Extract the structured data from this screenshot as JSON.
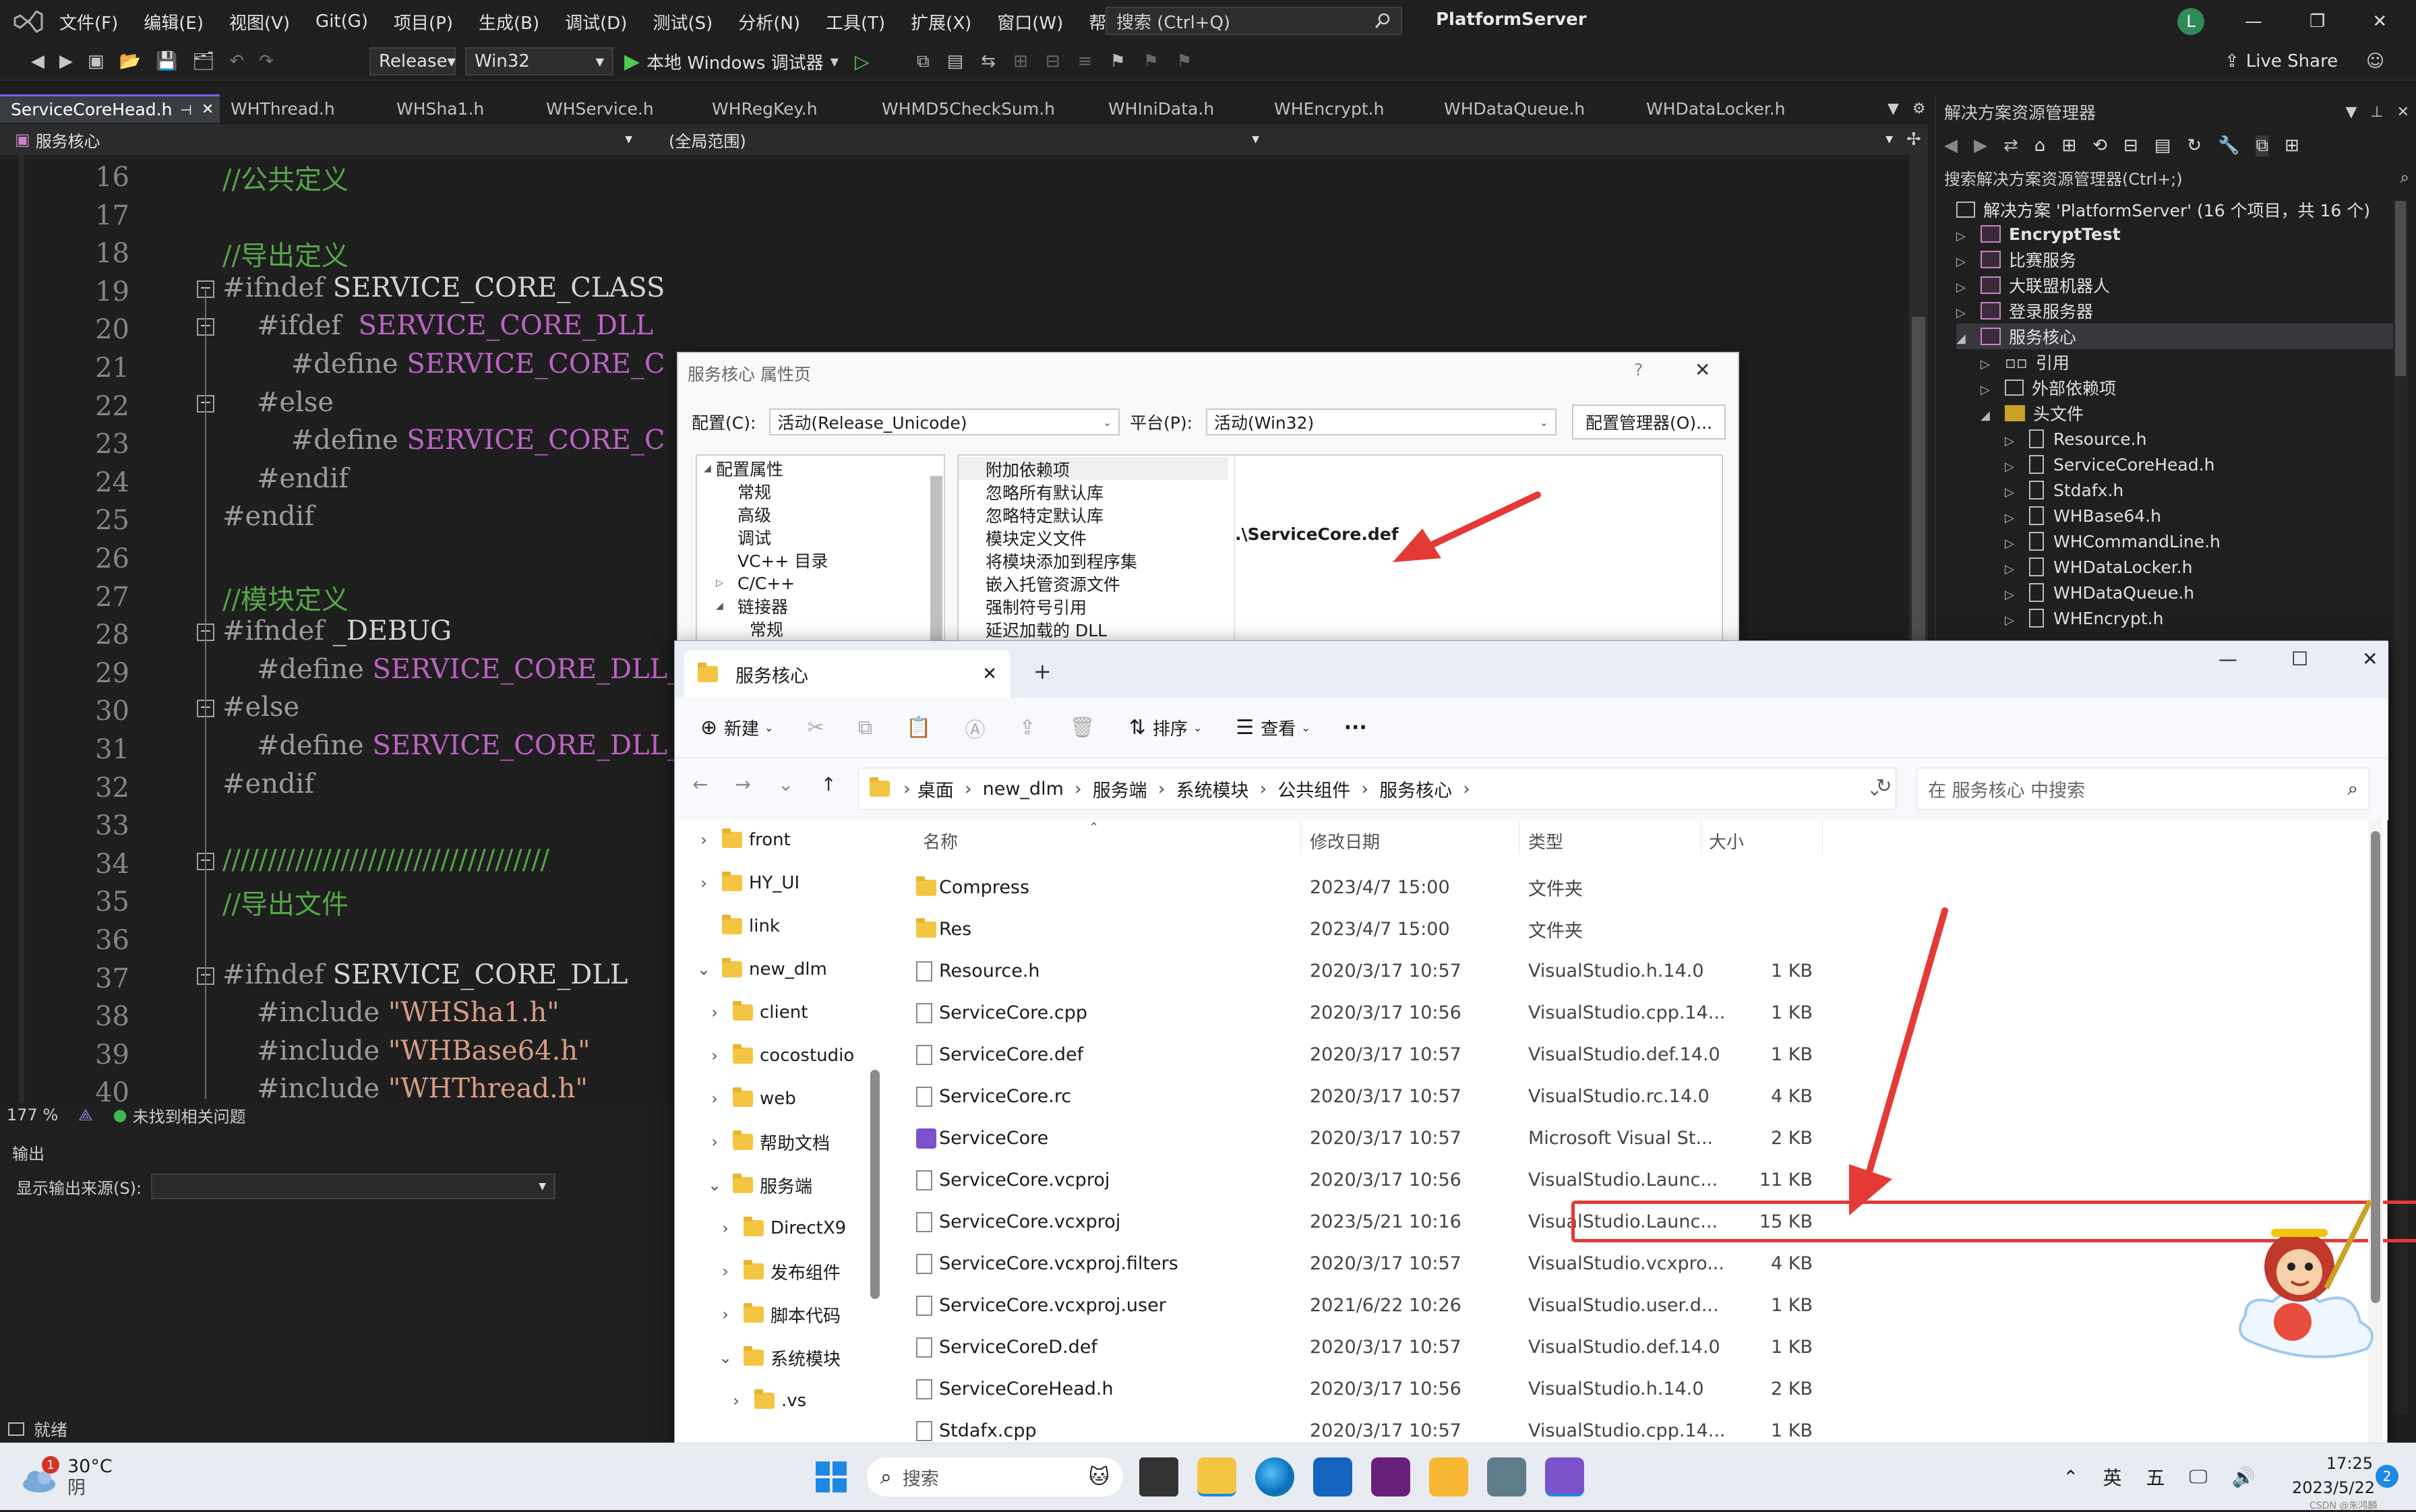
{
  "vs": {
    "menu": [
      "文件(F)",
      "编辑(E)",
      "视图(V)",
      "Git(G)",
      "项目(P)",
      "生成(B)",
      "调试(D)",
      "测试(S)",
      "分析(N)",
      "工具(T)",
      "扩展(X)",
      "窗口(W)",
      "帮助(H)"
    ],
    "search_placeholder": "搜索 (Ctrl+Q)",
    "window_title": "PlatformServer",
    "user_initial": "L",
    "toolbar": {
      "config": "Release",
      "platform": "Win32",
      "debugger": "本地 Windows 调试器",
      "live_share": "Live Share"
    },
    "tabs": [
      "ServiceCoreHead.h",
      "WHThread.h",
      "WHSha1.h",
      "WHService.h",
      "WHRegKey.h",
      "WHMD5CheckSum.h",
      "WHIniData.h",
      "WHEncrypt.h",
      "WHDataQueue.h",
      "WHDataLocker.h"
    ],
    "nav_project": "服务核心",
    "nav_scope": "(全局范围)",
    "code_lines": [
      {
        "num": "16",
        "text": "//公共定义"
      },
      {
        "num": "17",
        "text": ""
      },
      {
        "num": "18",
        "text": "//导出定义"
      },
      {
        "num": "19",
        "text": "#ifndef SERVICE_CORE_CLASS"
      },
      {
        "num": "20",
        "text": "    #ifdef  SERVICE_CORE_DLL"
      },
      {
        "num": "21",
        "text": "        #define SERVICE_CORE_C"
      },
      {
        "num": "22",
        "text": "    #else"
      },
      {
        "num": "23",
        "text": "        #define SERVICE_CORE_C"
      },
      {
        "num": "24",
        "text": "    #endif"
      },
      {
        "num": "25",
        "text": "#endif"
      },
      {
        "num": "26",
        "text": ""
      },
      {
        "num": "27",
        "text": "//模块定义"
      },
      {
        "num": "28",
        "text": "#ifndef _DEBUG"
      },
      {
        "num": "29",
        "text": "    #define SERVICE_CORE_DLL_"
      },
      {
        "num": "30",
        "text": "#else"
      },
      {
        "num": "31",
        "text": "    #define SERVICE_CORE_DLL_"
      },
      {
        "num": "32",
        "text": "#endif"
      },
      {
        "num": "33",
        "text": ""
      },
      {
        "num": "34",
        "text": "////////////////////////////////////"
      },
      {
        "num": "35",
        "text": "//导出文件"
      },
      {
        "num": "36",
        "text": ""
      },
      {
        "num": "37",
        "text": "#ifndef SERVICE_CORE_DLL"
      },
      {
        "num": "38",
        "text": "    #include \"WHSha1.h\""
      },
      {
        "num": "39",
        "text": "    #include \"WHBase64.h\""
      },
      {
        "num": "40",
        "text": "    #include \"WHThread.h\""
      }
    ],
    "zoom": "177 %",
    "issues": "未找到相关问题",
    "output_title": "输出",
    "output_source_label": "显示输出来源(S):",
    "status_ready": "就绪",
    "solution": {
      "title": "解决方案资源管理器",
      "search": "搜索解决方案资源管理器(Ctrl+;)",
      "root": "解决方案 'PlatformServer' (16 个项目，共 16 个)",
      "items": [
        {
          "label": "EncryptTest",
          "bold": true
        },
        {
          "label": "比赛服务"
        },
        {
          "label": "大联盟机器人"
        },
        {
          "label": "登录服务器"
        },
        {
          "label": "服务核心"
        },
        {
          "label": "引用"
        },
        {
          "label": "外部依赖项"
        },
        {
          "label": "头文件"
        },
        {
          "label": "Resource.h"
        },
        {
          "label": "ServiceCoreHead.h"
        },
        {
          "label": "Stdafx.h"
        },
        {
          "label": "WHBase64.h"
        },
        {
          "label": "WHCommandLine.h"
        },
        {
          "label": "WHDataLocker.h"
        },
        {
          "label": "WHDataQueue.h"
        },
        {
          "label": "WHEncrypt.h"
        }
      ]
    }
  },
  "prop_dialog": {
    "title": "服务核心 属性页",
    "help": "?",
    "config_label": "配置(C):",
    "config_value": "活动(Release_Unicode)",
    "platform_label": "平台(P):",
    "platform_value": "活动(Win32)",
    "config_manager": "配置管理器(O)...",
    "tree": [
      "配置属性",
      "常规",
      "高级",
      "调试",
      "VC++ 目录",
      "C/C++",
      "链接器",
      "常规"
    ],
    "props": [
      "附加依赖项",
      "忽略所有默认库",
      "忽略特定默认库",
      "模块定义文件",
      "将模块添加到程序集",
      "嵌入托管资源文件",
      "强制符号引用",
      "延迟加载的 DLL"
    ],
    "def_value": ".\\ServiceCore.def"
  },
  "explorer": {
    "tab_title": "服务核心",
    "toolbar": {
      "new": "新建",
      "sort": "排序",
      "view": "查看",
      "more": "···"
    },
    "breadcrumb": [
      "桌面",
      "new_dlm",
      "服务端",
      "系统模块",
      "公共组件",
      "服务核心"
    ],
    "search_placeholder": "在 服务核心 中搜索",
    "columns": [
      "名称",
      "修改日期",
      "类型",
      "大小"
    ],
    "nav": [
      {
        "label": "front",
        "expanded": false
      },
      {
        "label": "HY_UI",
        "expanded": false
      },
      {
        "label": "link",
        "expanded": null
      },
      {
        "label": "new_dlm",
        "expanded": true
      },
      {
        "label": "client",
        "expanded": false
      },
      {
        "label": "cocostudio",
        "expanded": false
      },
      {
        "label": "web",
        "expanded": false
      },
      {
        "label": "帮助文档",
        "expanded": false
      },
      {
        "label": "服务端",
        "expanded": true
      },
      {
        "label": "DirectX9",
        "expanded": false
      },
      {
        "label": "发布组件",
        "expanded": false
      },
      {
        "label": "脚本代码",
        "expanded": false
      },
      {
        "label": "系统模块",
        "expanded": true
      },
      {
        "label": ".vs",
        "expanded": false
      }
    ],
    "files": [
      {
        "name": "Compress",
        "date": "2023/4/7 15:00",
        "type": "文件夹",
        "size": "",
        "kind": "folder"
      },
      {
        "name": "Res",
        "date": "2023/4/7 15:00",
        "type": "文件夹",
        "size": "",
        "kind": "folder"
      },
      {
        "name": "Resource.h",
        "date": "2020/3/17 10:57",
        "type": "VisualStudio.h.14.0",
        "size": "1 KB",
        "kind": "file"
      },
      {
        "name": "ServiceCore.cpp",
        "date": "2020/3/17 10:56",
        "type": "VisualStudio.cpp.14...",
        "size": "1 KB",
        "kind": "file"
      },
      {
        "name": "ServiceCore.def",
        "date": "2020/3/17 10:57",
        "type": "VisualStudio.def.14.0",
        "size": "1 KB",
        "kind": "file"
      },
      {
        "name": "ServiceCore.rc",
        "date": "2020/3/17 10:57",
        "type": "VisualStudio.rc.14.0",
        "size": "4 KB",
        "kind": "file"
      },
      {
        "name": "ServiceCore",
        "date": "2020/3/17 10:57",
        "type": "Microsoft Visual St...",
        "size": "2 KB",
        "kind": "vs"
      },
      {
        "name": "ServiceCore.vcproj",
        "date": "2020/3/17 10:56",
        "type": "VisualStudio.Launc...",
        "size": "11 KB",
        "kind": "file"
      },
      {
        "name": "ServiceCore.vcxproj",
        "date": "2023/5/21 10:16",
        "type": "VisualStudio.Launc...",
        "size": "15 KB",
        "kind": "file"
      },
      {
        "name": "ServiceCore.vcxproj.filters",
        "date": "2020/3/17 10:57",
        "type": "VisualStudio.vcxpro...",
        "size": "4 KB",
        "kind": "file"
      },
      {
        "name": "ServiceCore.vcxproj.user",
        "date": "2021/6/22 10:26",
        "type": "VisualStudio.user.d...",
        "size": "1 KB",
        "kind": "file"
      },
      {
        "name": "ServiceCoreD.def",
        "date": "2020/3/17 10:57",
        "type": "VisualStudio.def.14.0",
        "size": "1 KB",
        "kind": "file"
      },
      {
        "name": "ServiceCoreHead.h",
        "date": "2020/3/17 10:56",
        "type": "VisualStudio.h.14.0",
        "size": "2 KB",
        "kind": "file"
      },
      {
        "name": "Stdafx.cpp",
        "date": "2020/3/17 10:57",
        "type": "VisualStudio.cpp.14...",
        "size": "1 KB",
        "kind": "file"
      }
    ],
    "highlight_color": "#e53935"
  },
  "taskbar": {
    "weather_temp": "30°C",
    "weather_desc": "阴",
    "weather_badge": "1",
    "search": "搜索",
    "ime1": "英",
    "ime2": "五",
    "time": "17:25",
    "date": "2023/5/22",
    "notif_count": "2",
    "watermark": "CSDN @朱鸿麟"
  },
  "colors": {
    "accent": "#7a5ee8",
    "arrow": "#e53935",
    "vs_bg": "#1f1f1f"
  }
}
